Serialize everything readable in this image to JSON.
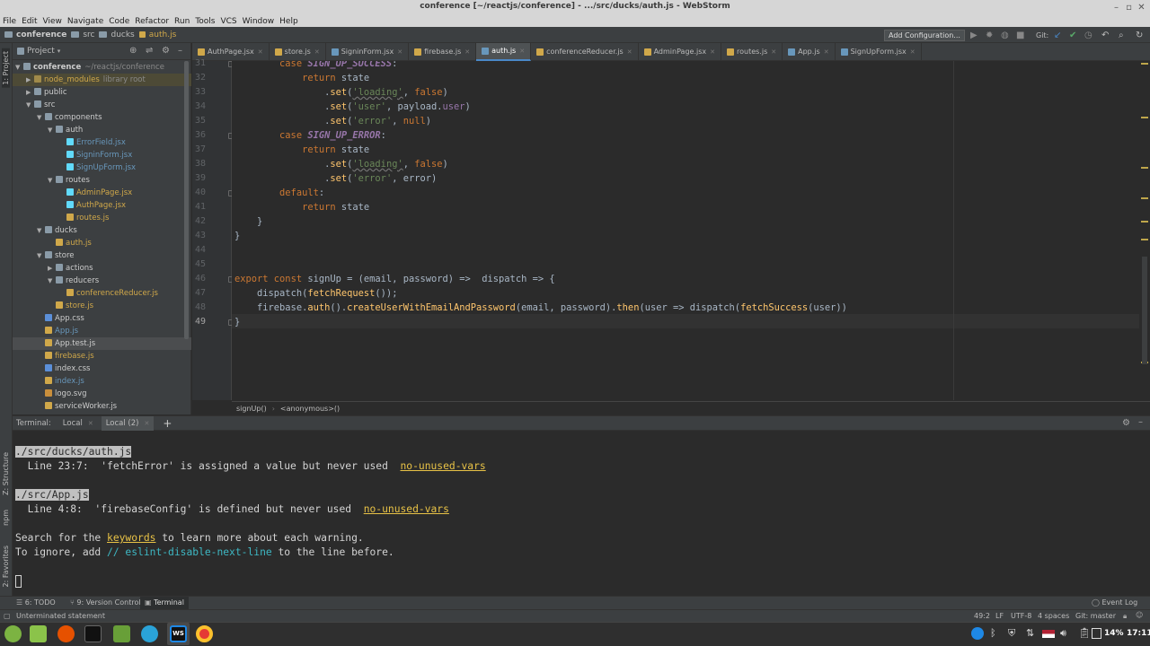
{
  "window": {
    "title": "conference [~/reactjs/conference] - .../src/ducks/auth.js - WebStorm"
  },
  "menu": [
    "File",
    "Edit",
    "View",
    "Navigate",
    "Code",
    "Refactor",
    "Run",
    "Tools",
    "VCS",
    "Window",
    "Help"
  ],
  "breadcrumb": {
    "project": "conference",
    "dir1": "src",
    "dir2": "ducks",
    "file": "auth.js"
  },
  "toolbar": {
    "add_config": "Add Configuration...",
    "git_label": "Git:"
  },
  "left_strip": {
    "project": "1: Project",
    "structure": "Z: Structure",
    "npm": "npm",
    "favorites": "2: Favorites"
  },
  "project_panel": {
    "title": "Project",
    "rows": [
      {
        "label": "conference",
        "sub": "~/reactjs/conference",
        "depth": 0,
        "arrow": "▼",
        "type": "folder",
        "color": "#cccccc",
        "bold": true
      },
      {
        "label": "node_modules",
        "sub": "library root",
        "depth": 1,
        "arrow": "▶",
        "type": "folder-lib",
        "color": "#d0a84a"
      },
      {
        "label": "public",
        "depth": 1,
        "arrow": "▶",
        "type": "folder",
        "color": "#cccccc"
      },
      {
        "label": "src",
        "depth": 1,
        "arrow": "▼",
        "type": "folder",
        "color": "#cccccc"
      },
      {
        "label": "components",
        "depth": 2,
        "arrow": "▼",
        "type": "folder",
        "color": "#cccccc"
      },
      {
        "label": "auth",
        "depth": 3,
        "arrow": "▼",
        "type": "folder",
        "color": "#cccccc"
      },
      {
        "label": "ErrorField.jsx",
        "depth": 4,
        "arrow": "",
        "type": "jsx",
        "color": "#6897bb"
      },
      {
        "label": "SigninForm.jsx",
        "depth": 4,
        "arrow": "",
        "type": "jsx",
        "color": "#6897bb"
      },
      {
        "label": "SignUpForm.jsx",
        "depth": 4,
        "arrow": "",
        "type": "jsx",
        "color": "#6897bb"
      },
      {
        "label": "routes",
        "depth": 3,
        "arrow": "▼",
        "type": "folder",
        "color": "#cccccc"
      },
      {
        "label": "AdminPage.jsx",
        "depth": 4,
        "arrow": "",
        "type": "jsx",
        "color": "#d0a84a"
      },
      {
        "label": "AuthPage.jsx",
        "depth": 4,
        "arrow": "",
        "type": "jsx",
        "color": "#d0a84a"
      },
      {
        "label": "routes.js",
        "depth": 4,
        "arrow": "",
        "type": "js",
        "color": "#d0a84a"
      },
      {
        "label": "ducks",
        "depth": 2,
        "arrow": "▼",
        "type": "folder",
        "color": "#cccccc"
      },
      {
        "label": "auth.js",
        "depth": 3,
        "arrow": "",
        "type": "js",
        "color": "#d0a84a"
      },
      {
        "label": "store",
        "depth": 2,
        "arrow": "▼",
        "type": "folder",
        "color": "#cccccc"
      },
      {
        "label": "actions",
        "depth": 3,
        "arrow": "▶",
        "type": "folder",
        "color": "#cccccc"
      },
      {
        "label": "reducers",
        "depth": 3,
        "arrow": "▼",
        "type": "folder",
        "color": "#cccccc"
      },
      {
        "label": "conferenceReducer.js",
        "depth": 4,
        "arrow": "",
        "type": "js",
        "color": "#d0a84a"
      },
      {
        "label": "store.js",
        "depth": 3,
        "arrow": "",
        "type": "js",
        "color": "#d0a84a"
      },
      {
        "label": "App.css",
        "depth": 2,
        "arrow": "",
        "type": "css",
        "color": "#cccccc"
      },
      {
        "label": "App.js",
        "depth": 2,
        "arrow": "",
        "type": "js",
        "color": "#6897bb"
      },
      {
        "label": "App.test.js",
        "depth": 2,
        "arrow": "",
        "type": "js",
        "color": "#cccccc",
        "selected": true
      },
      {
        "label": "firebase.js",
        "depth": 2,
        "arrow": "",
        "type": "js",
        "color": "#d0a84a"
      },
      {
        "label": "index.css",
        "depth": 2,
        "arrow": "",
        "type": "css",
        "color": "#cccccc"
      },
      {
        "label": "index.js",
        "depth": 2,
        "arrow": "",
        "type": "js",
        "color": "#6897bb"
      },
      {
        "label": "logo.svg",
        "depth": 2,
        "arrow": "",
        "type": "svg",
        "color": "#cccccc"
      },
      {
        "label": "serviceWorker.js",
        "depth": 2,
        "arrow": "",
        "type": "js",
        "color": "#cccccc"
      }
    ]
  },
  "tabs": [
    {
      "label": "AuthPage.jsx",
      "color": "#d0a84a"
    },
    {
      "label": "store.js",
      "color": "#d0a84a"
    },
    {
      "label": "SigninForm.jsx",
      "color": "#6897bb"
    },
    {
      "label": "firebase.js",
      "color": "#d0a84a"
    },
    {
      "label": "auth.js",
      "color": "#6897bb",
      "active": true
    },
    {
      "label": "conferenceReducer.js",
      "color": "#d0a84a"
    },
    {
      "label": "AdminPage.jsx",
      "color": "#d0a84a"
    },
    {
      "label": "routes.js",
      "color": "#d0a84a"
    },
    {
      "label": "App.js",
      "color": "#6897bb"
    },
    {
      "label": "SignUpForm.jsx",
      "color": "#6897bb"
    }
  ],
  "editor": {
    "lines": [
      {
        "n": "31",
        "tokens": [
          [
            "        ",
            ""
          ],
          [
            "case ",
            "kw"
          ],
          [
            "SIGN_UP_SUCCESS",
            "cn"
          ],
          [
            ":",
            ""
          ]
        ]
      },
      {
        "n": "32",
        "tokens": [
          [
            "            ",
            ""
          ],
          [
            "return ",
            "kw"
          ],
          [
            "state",
            ""
          ]
        ]
      },
      {
        "n": "33",
        "tokens": [
          [
            "                .",
            ""
          ],
          [
            "set",
            "fn"
          ],
          [
            "(",
            ""
          ],
          [
            "'loading'",
            "st un"
          ],
          [
            ", ",
            ""
          ],
          [
            "false",
            "kw"
          ],
          [
            ")",
            ""
          ]
        ]
      },
      {
        "n": "34",
        "tokens": [
          [
            "                .",
            ""
          ],
          [
            "set",
            "fn"
          ],
          [
            "(",
            ""
          ],
          [
            "'user'",
            "st"
          ],
          [
            ", payload.",
            ""
          ],
          [
            "user",
            "pr"
          ],
          [
            ")",
            ""
          ]
        ]
      },
      {
        "n": "35",
        "tokens": [
          [
            "                .",
            ""
          ],
          [
            "set",
            "fn"
          ],
          [
            "(",
            ""
          ],
          [
            "'error'",
            "st"
          ],
          [
            ", ",
            ""
          ],
          [
            "null",
            "kw"
          ],
          [
            ")",
            ""
          ]
        ]
      },
      {
        "n": "36",
        "tokens": [
          [
            "        ",
            ""
          ],
          [
            "case ",
            "kw"
          ],
          [
            "SIGN_UP_ERROR",
            "cn"
          ],
          [
            ":",
            ""
          ]
        ]
      },
      {
        "n": "37",
        "tokens": [
          [
            "            ",
            ""
          ],
          [
            "return ",
            "kw"
          ],
          [
            "state",
            ""
          ]
        ]
      },
      {
        "n": "38",
        "tokens": [
          [
            "                .",
            ""
          ],
          [
            "set",
            "fn"
          ],
          [
            "(",
            ""
          ],
          [
            "'loading'",
            "st un"
          ],
          [
            ", ",
            ""
          ],
          [
            "false",
            "kw"
          ],
          [
            ")",
            ""
          ]
        ]
      },
      {
        "n": "39",
        "tokens": [
          [
            "                .",
            ""
          ],
          [
            "set",
            "fn"
          ],
          [
            "(",
            ""
          ],
          [
            "'error'",
            "st"
          ],
          [
            ", error)",
            ""
          ]
        ]
      },
      {
        "n": "40",
        "tokens": [
          [
            "        ",
            ""
          ],
          [
            "default",
            "kw"
          ],
          [
            ":",
            ""
          ]
        ]
      },
      {
        "n": "41",
        "tokens": [
          [
            "            ",
            ""
          ],
          [
            "return ",
            "kw"
          ],
          [
            "state",
            ""
          ]
        ]
      },
      {
        "n": "42",
        "tokens": [
          [
            "    }",
            ""
          ]
        ]
      },
      {
        "n": "43",
        "tokens": [
          [
            "}",
            ""
          ]
        ]
      },
      {
        "n": "44",
        "tokens": []
      },
      {
        "n": "45",
        "tokens": []
      },
      {
        "n": "46",
        "tokens": [
          [
            "export ",
            "kw"
          ],
          [
            "const ",
            "kw"
          ],
          [
            "signUp",
            ""
          ],
          [
            " = (email, password) =>  dispatch => {",
            ""
          ]
        ]
      },
      {
        "n": "47",
        "tokens": [
          [
            "    ",
            ""
          ],
          [
            "dispatch",
            ""
          ],
          [
            "(",
            ""
          ],
          [
            "fetchRequest",
            "fn"
          ],
          [
            "());",
            ""
          ]
        ]
      },
      {
        "n": "48",
        "tokens": [
          [
            "    firebase.",
            ""
          ],
          [
            "auth",
            "fn"
          ],
          [
            "().",
            ""
          ],
          [
            "createUserWithEmailAndPassword",
            "fn"
          ],
          [
            "(email, password).",
            ""
          ],
          [
            "then",
            "fn"
          ],
          [
            "(user => dispatch(",
            ""
          ],
          [
            "fetchSuccess",
            "fn"
          ],
          [
            "(user))",
            ""
          ]
        ]
      },
      {
        "n": "49",
        "tokens": [
          [
            "}",
            ""
          ]
        ]
      }
    ],
    "breadcrumb": [
      "signUp()",
      "<anonymous>()"
    ]
  },
  "terminal": {
    "label": "Terminal:",
    "tabs": [
      "Local",
      "Local (2)"
    ],
    "add": "+",
    "lines": [
      {
        "segments": [
          [
            "./src/ducks/auth.js",
            "inv"
          ]
        ]
      },
      {
        "segments": [
          [
            "  Line 23:7:  'fetchError' is assigned a value but never used  ",
            ""
          ],
          [
            "no-unused-vars",
            "yl"
          ]
        ]
      },
      {
        "segments": []
      },
      {
        "segments": [
          [
            "./src/App.js",
            "inv"
          ]
        ]
      },
      {
        "segments": [
          [
            "  Line 4:8:  'firebaseConfig' is defined but never used  ",
            ""
          ],
          [
            "no-unused-vars",
            "yl"
          ]
        ]
      },
      {
        "segments": []
      },
      {
        "segments": [
          [
            "Search for the ",
            ""
          ],
          [
            "keywords",
            "yl"
          ],
          [
            " to learn more about each warning.",
            ""
          ]
        ]
      },
      {
        "segments": [
          [
            "To ignore, add ",
            ""
          ],
          [
            "// eslint-disable-next-line",
            "cy"
          ],
          [
            " to the line before.",
            ""
          ]
        ]
      }
    ]
  },
  "bottom_tabs": {
    "todo": "6: TODO",
    "vcs": "9: Version Control",
    "terminal": "Terminal",
    "event_log": "Event Log"
  },
  "status": {
    "message": "Unterminated statement",
    "position": "49:2",
    "line_sep": "LF",
    "encoding": "UTF-8",
    "indent": "4 spaces",
    "git": "Git: master"
  },
  "taskbar": {
    "battery": "14%",
    "time": "17:11"
  }
}
